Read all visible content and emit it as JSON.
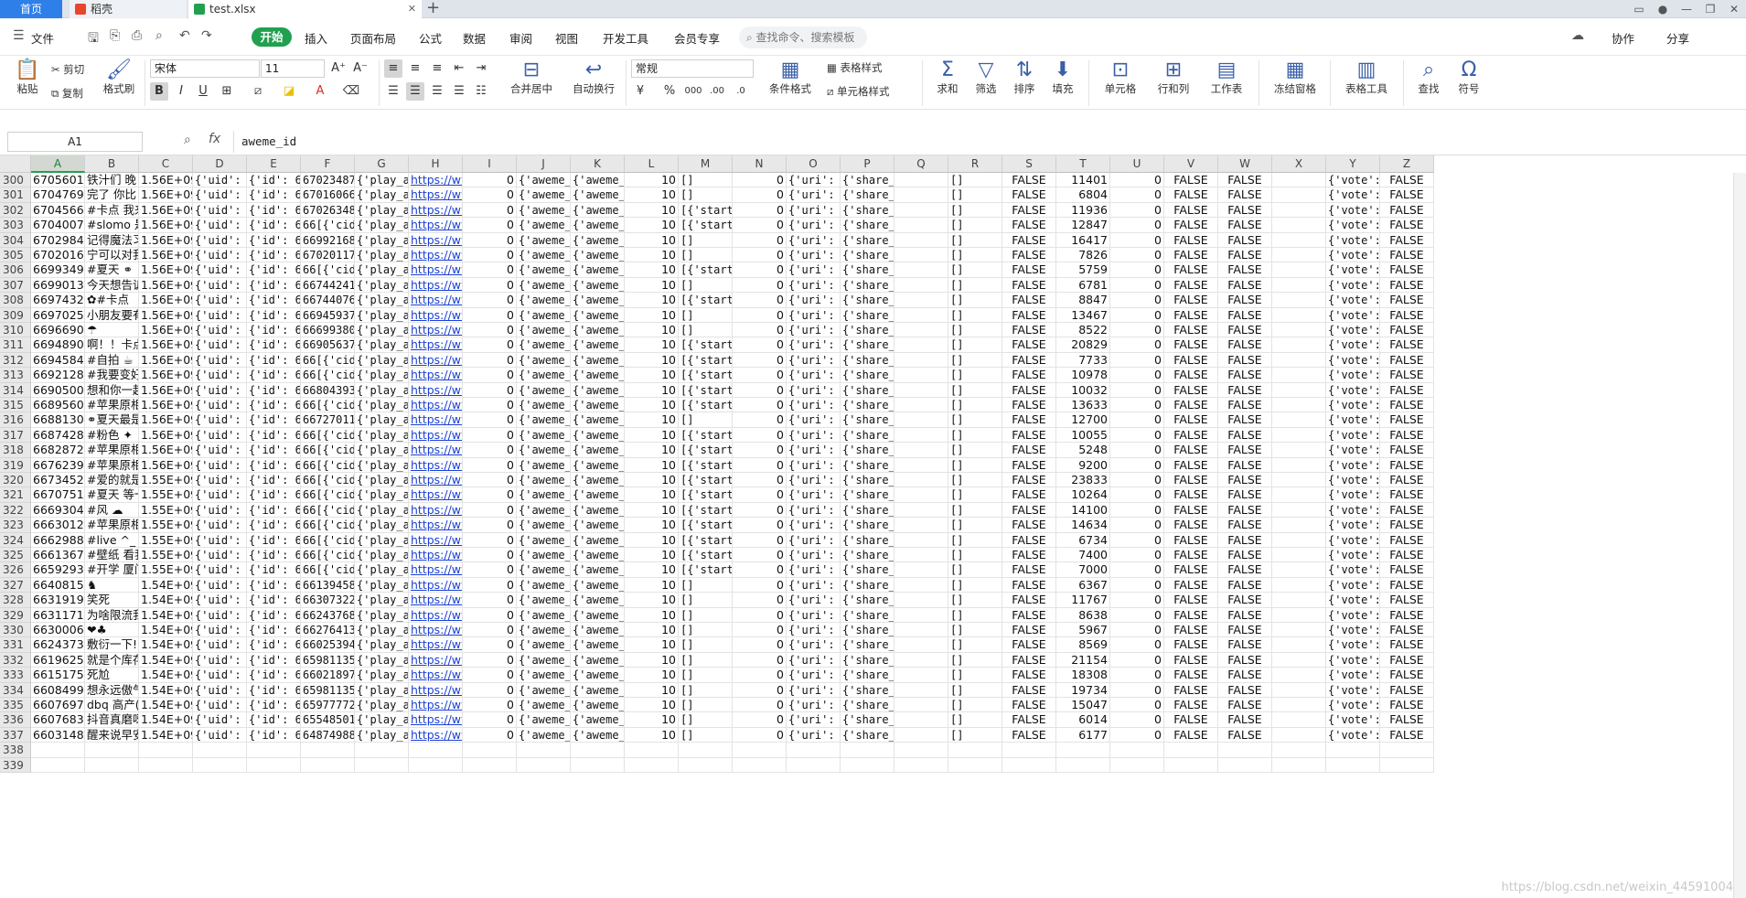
{
  "titlebar": {
    "tabs": [
      {
        "label": "首页"
      },
      {
        "label": "稻壳"
      },
      {
        "label": "test.xlsx"
      }
    ],
    "add_tab": "+"
  },
  "menubar": {
    "file_label": "文件",
    "items": [
      "开始",
      "插入",
      "页面布局",
      "公式",
      "数据",
      "审阅",
      "视图",
      "开发工具",
      "会员专享"
    ],
    "search_placeholder": "查找命令、搜索模板",
    "right": [
      "协作",
      "分享"
    ]
  },
  "ribbon": {
    "paste": "粘贴",
    "cut": "剪切",
    "copy": "复制",
    "format_painter": "格式刷",
    "font_name": "宋体",
    "font_size": "11",
    "number_format": "常规",
    "merge": "合并居中",
    "wrap": "自动换行",
    "table_style": "表格样式",
    "cell_style": "单元格样式",
    "cond_format": "条件格式",
    "sum": "求和",
    "filter": "筛选",
    "sort": "排序",
    "fill": "填充",
    "cell": "单元格",
    "rowcol": "行和列",
    "sheet": "工作表",
    "freeze": "冻结窗格",
    "table_tools": "表格工具",
    "find": "查找",
    "symbol": "符号"
  },
  "formula_bar": {
    "cell_ref": "A1",
    "fx": "fx",
    "content": "aweme_id"
  },
  "columns": [
    "A",
    "B",
    "C",
    "D",
    "E",
    "F",
    "G",
    "H",
    "I",
    "J",
    "K",
    "L",
    "M",
    "N",
    "O",
    "P",
    "Q",
    "R",
    "S",
    "T",
    "U",
    "V",
    "W",
    "X",
    "Y",
    "Z"
  ],
  "rows": [
    {
      "n": "300",
      "a": "67056015",
      "b": "铁汁们 晚",
      "e": "{'id': 6702348769",
      "j": "{'aweme_i",
      "m": "[]",
      "t": "11401"
    },
    {
      "n": "301",
      "a": "67047691",
      "b": "完了 你比",
      "e": "{'id': 6701606673",
      "j": "{'aweme_i",
      "m": "[]",
      "t": "6804"
    },
    {
      "n": "302",
      "a": "67045667",
      "b": "#卡点 我来",
      "e": "{'id': 6702634858",
      "j": "{'aweme_i",
      "m": "[{'start'",
      "t": "11936"
    },
    {
      "n": "303",
      "a": "67040074",
      "b": "#slomo 是",
      "e": "{'id': 66[{'cid':",
      "j": "{'aweme_i",
      "m": "[{'start'",
      "t": "12847"
    },
    {
      "n": "304",
      "a": "67029844",
      "b": "记得魔法习",
      "e": "{'id': 6699216878",
      "j": "{'aweme_i",
      "m": "[]",
      "t": "16417"
    },
    {
      "n": "305",
      "a": "67020164",
      "b": "宁可以对我",
      "e": "{'id': 6702011789",
      "j": "{'aweme_i",
      "m": "[]",
      "t": "7826"
    },
    {
      "n": "306",
      "a": "66993499",
      "b": "#夏天 ⚭",
      "e": "{'id': 66[{'cid':",
      "j": "{'aweme_i",
      "m": "[{'start'",
      "t": "5759"
    },
    {
      "n": "307",
      "a": "66990138",
      "b": "今天想告诉",
      "e": "{'id': 6674424117",
      "j": "{'aweme_i",
      "m": "[]",
      "t": "6781"
    },
    {
      "n": "308",
      "a": "66974320",
      "b": "✿#卡点",
      "e": "{'id': 6674407643",
      "j": "{'aweme_i",
      "m": "[{'start'",
      "t": "8847"
    },
    {
      "n": "309",
      "a": "66970254",
      "b": "小朋友要有",
      "e": "{'id': 6694593752",
      "j": "{'aweme_i",
      "m": "[]",
      "t": "13467"
    },
    {
      "n": "310",
      "a": "66966906",
      "b": "☂",
      "e": "{'id': 6669938014",
      "j": "{'aweme_i",
      "m": "[]",
      "t": "8522"
    },
    {
      "n": "311",
      "a": "66948906",
      "b": "啊！！卡点",
      "e": "{'id': 6690563721",
      "j": "{'aweme_i",
      "m": "[{'start'",
      "t": "20829"
    },
    {
      "n": "312",
      "a": "66945845",
      "b": "#自拍 ☕",
      "e": "{'id': 66[{'cid':",
      "j": "{'aweme_i",
      "m": "[{'start'",
      "t": "7733"
    },
    {
      "n": "313",
      "a": "66921283",
      "b": "#我要变好",
      "e": "{'id': 66[{'cid':",
      "j": "{'aweme_i",
      "m": "[{'start'",
      "t": "10978"
    },
    {
      "n": "314",
      "a": "66905000",
      "b": "想和你一起",
      "e": "{'id': 6680439301",
      "j": "{'aweme_i",
      "m": "[{'start'",
      "t": "10032"
    },
    {
      "n": "315",
      "a": "66895607",
      "b": "#苹果原相",
      "e": "{'id': 66[{'cid':",
      "j": "{'aweme_i",
      "m": "[{'start'",
      "t": "13633"
    },
    {
      "n": "316",
      "a": "66881307",
      "b": "⚭夏天最是",
      "e": "{'id': 6672701118",
      "j": "{'aweme_i",
      "m": "[]",
      "t": "12700"
    },
    {
      "n": "317",
      "a": "66874289",
      "b": "#粉色 ✦",
      "e": "{'id': 66[{'cid':",
      "j": "{'aweme_i",
      "m": "[{'start'",
      "t": "10055"
    },
    {
      "n": "318",
      "a": "66828724",
      "b": "#苹果原相",
      "e": "{'id': 66[{'cid':",
      "j": "{'aweme_i",
      "m": "[{'start'",
      "t": "5248"
    },
    {
      "n": "319",
      "a": "66762391",
      "b": "#苹果原相",
      "e": "{'id': 66[{'cid':",
      "j": "{'aweme_i",
      "m": "[{'start'",
      "t": "9200"
    },
    {
      "n": "320",
      "a": "66734521",
      "b": "#爱的就是",
      "e": "{'id': 66[{'cid':",
      "j": "{'aweme_i",
      "m": "[{'start'",
      "t": "23833"
    },
    {
      "n": "321",
      "a": "66707512",
      "b": "#夏天 等一",
      "e": "{'id': 66[{'cid':",
      "j": "{'aweme_i",
      "m": "[{'start'",
      "t": "10264"
    },
    {
      "n": "322",
      "a": "66693042",
      "b": "#风 ☁",
      "e": "{'id': 66[{'cid':",
      "j": "{'aweme_i",
      "m": "[{'start'",
      "t": "14100"
    },
    {
      "n": "323",
      "a": "66630124",
      "b": "#苹果原相",
      "e": "{'id': 66[{'cid':",
      "j": "{'aweme_i",
      "m": "[{'start'",
      "t": "14634"
    },
    {
      "n": "324",
      "a": "66629889",
      "b": "#live ^_",
      "e": "{'id': 66[{'cid':",
      "j": "{'aweme_i",
      "m": "[{'start'",
      "t": "6734"
    },
    {
      "n": "325",
      "a": "66613674",
      "b": "#壁纸 看我",
      "e": "{'id': 66[{'cid':",
      "j": "{'aweme_i",
      "m": "[{'start'",
      "t": "7400"
    },
    {
      "n": "326",
      "a": "66592937",
      "b": "#开学 厦门",
      "e": "{'id': 66[{'cid':",
      "j": "{'aweme_i",
      "m": "[{'start'",
      "t": "7000"
    },
    {
      "n": "327",
      "a": "66408154",
      "b": "♞",
      "e": "{'id': 6613945823",
      "j": "{'aweme_i",
      "m": "[]",
      "t": "6367"
    },
    {
      "n": "328",
      "a": "66319196",
      "b": "笑死",
      "e": "{'id': 6630732244",
      "j": "{'aweme_i",
      "m": "[]",
      "t": "11767"
    },
    {
      "n": "329",
      "a": "66311711",
      "b": "为啥限流我",
      "e": "{'id': 6624376889",
      "j": "{'aweme_i",
      "m": "[]",
      "t": "8638"
    },
    {
      "n": "330",
      "a": "66300066",
      "b": "❤♣",
      "e": "{'id': 6627641325",
      "j": "{'aweme_i",
      "m": "[]",
      "t": "5967"
    },
    {
      "n": "331",
      "a": "66243733",
      "b": "敷衍一下!",
      "e": "{'id': 6602539416",
      "j": "{'aweme_i",
      "m": "[]",
      "t": "8569"
    },
    {
      "n": "332",
      "a": "66196255",
      "b": "就是个库存",
      "e": "{'id': 6598113542",
      "j": "{'aweme_i",
      "m": "[]",
      "t": "21154"
    },
    {
      "n": "333",
      "a": "66151756",
      "b": "死尬",
      "e": "{'id': 6602189710",
      "j": "{'aweme_i",
      "m": "[]",
      "t": "18308"
    },
    {
      "n": "334",
      "a": "66084990",
      "b": "想永远傲气",
      "e": "{'id': 6598113542",
      "j": "{'aweme_i",
      "m": "[]",
      "t": "19734"
    },
    {
      "n": "335",
      "a": "66076972",
      "b": "dbq 高产(",
      "e": "{'id': 6597777215",
      "j": "{'aweme_i",
      "m": "[]",
      "t": "15047"
    },
    {
      "n": "336",
      "a": "66076835",
      "b": "抖音真磨呀",
      "e": "{'id': 6554850151",
      "j": "{'aweme_i",
      "m": "[]",
      "t": "6014"
    },
    {
      "n": "337",
      "a": "66031484",
      "b": "醒来说早安",
      "e": "{'id': 6487498893",
      "j": "{'aweme_i",
      "m": "[]",
      "t": "6177"
    }
  ],
  "common": {
    "c_hi": "1.56E+09",
    "c_lo": "1.55E+09",
    "c_lo2": "1.54E+09",
    "d": "{'uid': '",
    "g": "{'play_ac",
    "h": "https://ww",
    "i": "0",
    "k": "{'aweme_i",
    "l": "10",
    "n": "0",
    "o": "{'uri': '",
    "p": "{'share_url': 'htt",
    "r": "[]",
    "s": "FALSE",
    "u": "0",
    "v": "FALSE",
    "w": "FALSE",
    "y": "{'vote':",
    "z": "FALSE"
  },
  "empty_rows": [
    "338",
    "339"
  ],
  "watermark": "https://blog.csdn.net/weixin_44591004"
}
